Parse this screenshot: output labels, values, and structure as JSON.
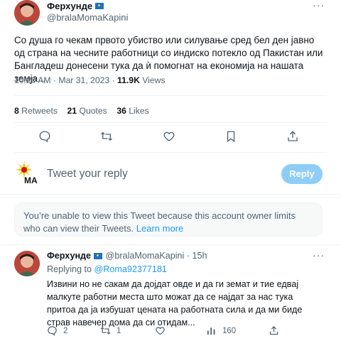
{
  "main_tweet": {
    "author_name": "Ферхунде",
    "author_handle": "@bralaMomaKapini",
    "more_label": "···",
    "text": "Со душа го чекам првото убиство или силување сред бел ден јавно од страна на чесните работници со индиско потекло од Пакистан или Бангладеш донесени тука да ѝ помогнат на економија на нашата земја...",
    "time": "10:20 AM",
    "date": "Mar 31, 2023",
    "sep": "·",
    "views_count": "11.9K",
    "views_label": "Views",
    "retweets_count": "8",
    "retweets_label": "Retweets",
    "quotes_count": "21",
    "quotes_label": "Quotes",
    "likes_count": "36",
    "likes_label": "Likes",
    "actions": [
      "reply-icon",
      "retweet-icon",
      "like-icon",
      "bookmark-icon",
      "share-icon"
    ]
  },
  "composer": {
    "placeholder": "Tweet your reply",
    "reply_button": "Reply"
  },
  "notice": {
    "text": "You’re unable to view this Tweet because this account owner limits who can view their Tweets.",
    "link": "Learn more"
  },
  "reply_tweet": {
    "author_name": "Ферхунде",
    "author_handle": "@bralaMomaKapini",
    "sep": "·",
    "age": "15h",
    "more_label": "···",
    "replying_prefix": "Replying to",
    "replying_handle": "@Roma92377181",
    "text": "Извини но не сакам да дојдат овде и да ги земат  и тие едвај малкуте работни места што можат да се најдат за нас тука притоа да ја избушат цената на работната сила и да ми биде страв навечер дома да си отидам...",
    "reply_count": "2",
    "retweet_count": "1",
    "like_count": "",
    "views_count": "160"
  },
  "colors": {
    "accent": "#1d9bf0",
    "reply_button_disabled": "#8ecdf8",
    "secondary_text": "#536471"
  }
}
